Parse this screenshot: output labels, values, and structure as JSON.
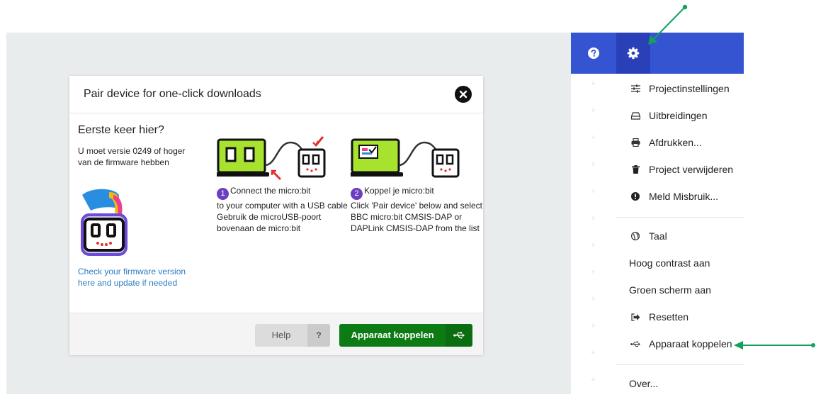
{
  "modal": {
    "title": "Pair device for one-click downloads",
    "first_time": "Eerste keer hier?",
    "firmware_note": "U moet versie 0249 of hoger van de firmware hebben",
    "firmware_link": "Check your firmware version here and update if needed",
    "step1": {
      "number": "1",
      "heading": "Connect the micro:bit",
      "text": "to your computer with a USB cable Gebruik de microUSB-poort bovenaan de micro:bit"
    },
    "step2": {
      "number": "2",
      "heading": "Koppel je micro:bit",
      "text": "Click 'Pair device' below and select BBC micro:bit CMSIS-DAP or DAPLink CMSIS-DAP from the list"
    },
    "help_label": "Help",
    "help_mark": "?",
    "pair_label": "Apparaat koppelen"
  },
  "menu": {
    "items": [
      {
        "label": "Projectinstellingen",
        "icon": "sliders-icon"
      },
      {
        "label": "Uitbreidingen",
        "icon": "drive-icon"
      },
      {
        "label": "Afdrukken...",
        "icon": "printer-icon"
      },
      {
        "label": "Project verwijderen",
        "icon": "trash-icon"
      },
      {
        "label": "Meld Misbruik...",
        "icon": "alert-icon"
      },
      {
        "label": "Taal",
        "icon": "globe-icon"
      },
      {
        "label": "Hoog contrast aan",
        "icon": ""
      },
      {
        "label": "Groen scherm aan",
        "icon": ""
      },
      {
        "label": "Resetten",
        "icon": "sign-out-icon"
      },
      {
        "label": "Apparaat koppelen",
        "icon": "usb-icon"
      },
      {
        "label": "Over...",
        "icon": ""
      }
    ]
  },
  "colors": {
    "topbar": "#3454d1",
    "pair_button": "#0c7b13",
    "annotation_arrow": "#12a05c",
    "step_badge": "#6b3fc1",
    "link": "#2b7bc1"
  }
}
